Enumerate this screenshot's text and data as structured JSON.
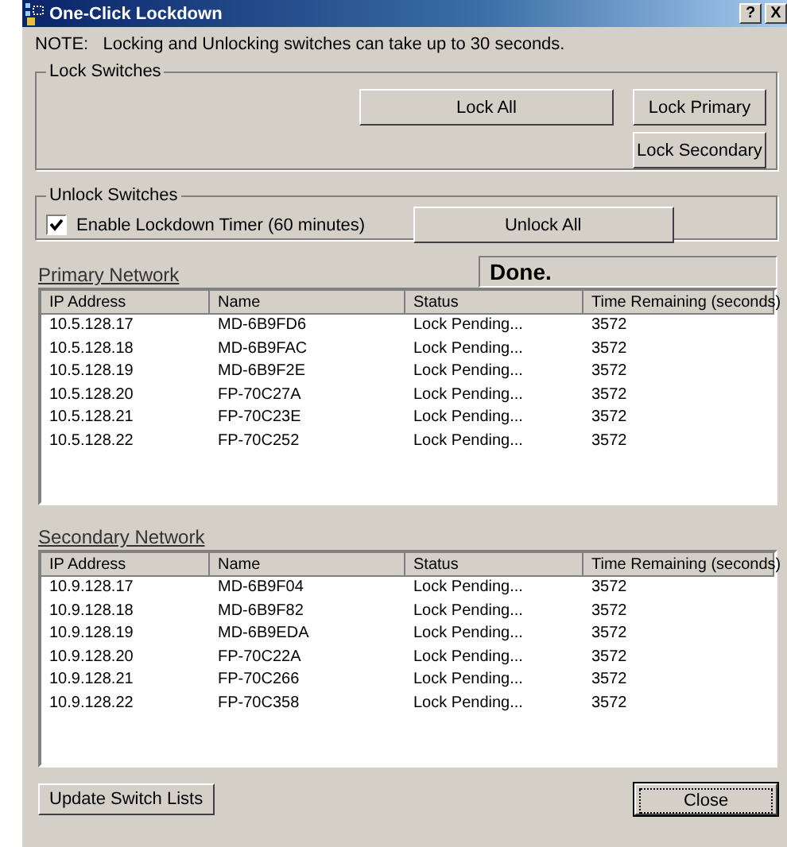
{
  "window": {
    "title": "One-Click Lockdown",
    "title_buttons": [
      "?",
      "X"
    ]
  },
  "note": "NOTE:   Locking and Unlocking switches can take up to 30 seconds.",
  "lock_group": {
    "title": "Lock Switches",
    "buttons": [
      "Lock All",
      "Lock Primary",
      "Lock Secondary"
    ]
  },
  "unlock_group": {
    "title": "Unlock Switches",
    "checkbox": {
      "label": "Enable Lockdown Timer (60 minutes)",
      "checked": true
    },
    "button": "Unlock All"
  },
  "status_field": "Done.",
  "tables": [
    {
      "title": "Primary Network",
      "columns": [
        "IP Address",
        "Name",
        "Status",
        "Time Remaining (seconds)"
      ],
      "rows": [
        [
          "10.5.128.17",
          "MD-6B9FD6",
          "Lock Pending...",
          "3572"
        ],
        [
          "10.5.128.18",
          "MD-6B9FAC",
          "Lock Pending...",
          "3572"
        ],
        [
          "10.5.128.19",
          "MD-6B9F2E",
          "Lock Pending...",
          "3572"
        ],
        [
          "10.5.128.20",
          "FP-70C27A",
          "Lock Pending...",
          "3572"
        ],
        [
          "10.5.128.21",
          "FP-70C23E",
          "Lock Pending...",
          "3572"
        ],
        [
          "10.5.128.22",
          "FP-70C252",
          "Lock Pending...",
          "3572"
        ]
      ]
    },
    {
      "title": "Secondary Network",
      "columns": [
        "IP Address",
        "Name",
        "Status",
        "Time Remaining (seconds)"
      ],
      "rows": [
        [
          "10.9.128.17",
          "MD-6B9F04",
          "Lock Pending...",
          "3572"
        ],
        [
          "10.9.128.18",
          "MD-6B9F82",
          "Lock Pending...",
          "3572"
        ],
        [
          "10.9.128.19",
          "MD-6B9EDA",
          "Lock Pending...",
          "3572"
        ],
        [
          "10.9.128.20",
          "FP-70C22A",
          "Lock Pending...",
          "3572"
        ],
        [
          "10.9.128.21",
          "FP-70C266",
          "Lock Pending...",
          "3572"
        ],
        [
          "10.9.128.22",
          "FP-70C358",
          "Lock Pending...",
          "3572"
        ]
      ]
    }
  ],
  "footer_buttons": [
    {
      "label": "Update Switch Lists",
      "default": false
    },
    {
      "label": "Close",
      "default": true
    }
  ]
}
